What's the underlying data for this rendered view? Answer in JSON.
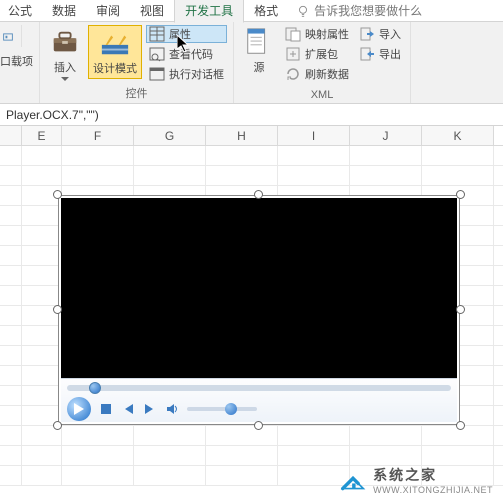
{
  "tabs": {
    "t0": "公式",
    "t1": "数据",
    "t2": "审阅",
    "t3": "视图",
    "t4": "开发工具",
    "t5": "格式"
  },
  "help": "告诉我您想要做什么",
  "addins_partial": "口载项",
  "ribbon": {
    "insert": "插入",
    "design": "设计模式",
    "props": "属性",
    "viewcode": "查看代码",
    "rundialog": "执行对话框",
    "controls_label": "控件",
    "source": "源",
    "mapprops": "映射属性",
    "expand": "扩展包",
    "refresh": "刷新数据",
    "import": "导入",
    "export": "导出",
    "xml_label": "XML"
  },
  "formula_text": "Player.OCX.7\",\"\")",
  "columns": [
    "E",
    "F",
    "G",
    "H",
    "I",
    "J",
    "K"
  ],
  "watermark": {
    "title": "系统之家",
    "url": "WWW.XITONGZHIJIA.NET"
  }
}
